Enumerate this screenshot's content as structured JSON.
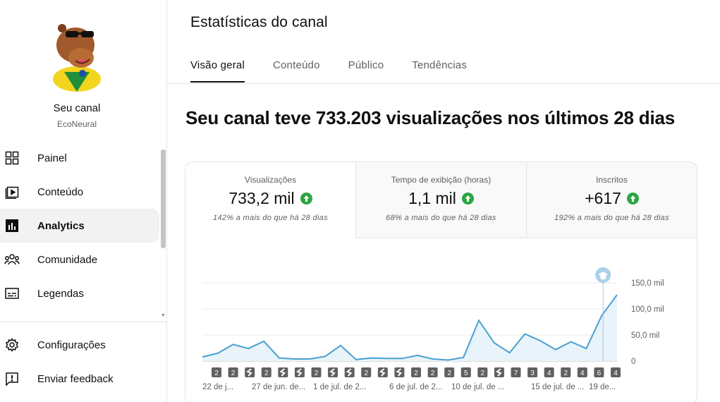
{
  "sidebar": {
    "channel_name": "Seu canal",
    "channel_handle": "EcoNeural",
    "items": [
      {
        "label": "Painel",
        "icon": "dashboard-icon"
      },
      {
        "label": "Conteúdo",
        "icon": "content-icon"
      },
      {
        "label": "Analytics",
        "icon": "analytics-icon",
        "active": true
      },
      {
        "label": "Comunidade",
        "icon": "community-icon"
      },
      {
        "label": "Legendas",
        "icon": "subtitles-icon"
      }
    ],
    "bottom_items": [
      {
        "label": "Configurações",
        "icon": "gear-icon"
      },
      {
        "label": "Enviar feedback",
        "icon": "feedback-icon"
      }
    ]
  },
  "header": {
    "title": "Estatísticas do canal",
    "tabs": [
      {
        "label": "Visão geral",
        "active": true
      },
      {
        "label": "Conteúdo"
      },
      {
        "label": "Público"
      },
      {
        "label": "Tendências"
      }
    ]
  },
  "headline": "Seu canal teve 733.203 visualizações nos últimos 28 dias",
  "metrics": [
    {
      "label": "Visualizações",
      "value": "733,2 mil",
      "sub": "142% a mais do que há 28 dias",
      "trend": "up"
    },
    {
      "label": "Tempo de exibição (horas)",
      "value": "1,1 mil",
      "sub": "68% a mais do que há 28 dias",
      "trend": "up"
    },
    {
      "label": "Inscritos",
      "value": "+617",
      "sub": "192% a mais do que há 28 dias",
      "trend": "up"
    }
  ],
  "colors": {
    "accent_line": "#4aa0d0",
    "area_fill": "#e8f3fa",
    "trend_up": "#2ba640",
    "badge": "#606060"
  },
  "chart_data": {
    "type": "area",
    "y_ticks": [
      "150,0 mil",
      "100,0 mil",
      "50,0 mil",
      "0"
    ],
    "ylim": [
      0,
      150000
    ],
    "values": [
      8000,
      15000,
      32000,
      24000,
      38000,
      6000,
      4000,
      4000,
      9000,
      30000,
      3000,
      6000,
      5000,
      5000,
      11000,
      4000,
      2000,
      7000,
      78000,
      35000,
      16000,
      52000,
      39000,
      22000,
      37000,
      24000,
      87000,
      127000
    ],
    "badges": [
      "2",
      "2",
      "short",
      "2",
      "short",
      "short",
      "2",
      "short",
      "short",
      "2",
      "short",
      "short",
      "2",
      "2",
      "2",
      "5",
      "2",
      "short",
      "7",
      "3",
      "4",
      "2",
      "4",
      "6",
      "4"
    ],
    "x_labels": [
      "22 de j...",
      "27 de jun. de...",
      "1 de jul. de 2...",
      "6 de jul. de 2...",
      "10 de jul. de ...",
      "15 de jul. de ...",
      "19 de..."
    ],
    "marker_icon": "education-cap-icon"
  }
}
